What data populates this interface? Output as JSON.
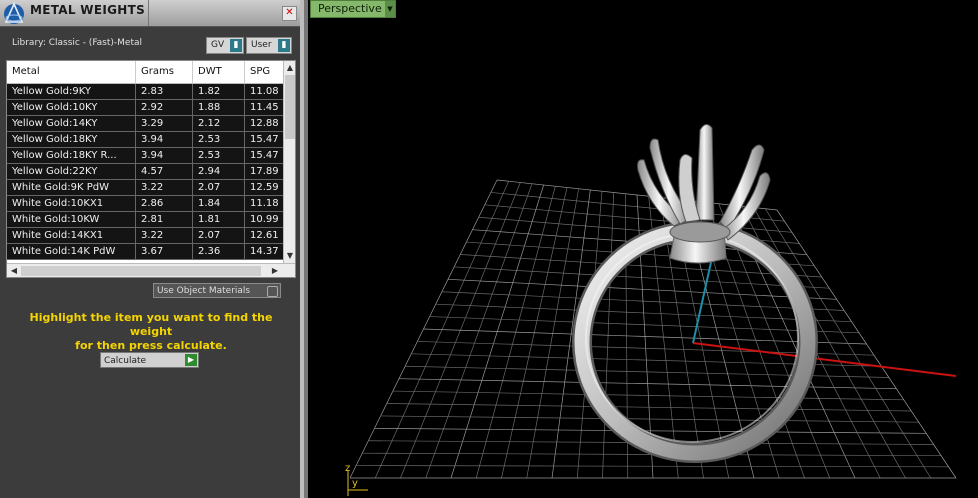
{
  "panel": {
    "title": "METAL WEIGHTS",
    "close_icon": "close-icon",
    "library": "Library: Classic - (Fast)-Metal",
    "toggle_gv": "GV",
    "toggle_user": "User",
    "columns": [
      "Metal",
      "Grams",
      "DWT",
      "SPG"
    ],
    "rows": [
      [
        "Yellow Gold:9KY",
        "2.83",
        "1.82",
        "11.08"
      ],
      [
        "Yellow Gold:10KY",
        "2.92",
        "1.88",
        "11.45"
      ],
      [
        "Yellow Gold:14KY",
        "3.29",
        "2.12",
        "12.88"
      ],
      [
        "Yellow Gold:18KY",
        "3.94",
        "2.53",
        "15.47"
      ],
      [
        "Yellow Gold:18KY R...",
        "3.94",
        "2.53",
        "15.47"
      ],
      [
        "Yellow Gold:22KY",
        "4.57",
        "2.94",
        "17.89"
      ],
      [
        "White Gold:9K PdW",
        "3.22",
        "2.07",
        "12.59"
      ],
      [
        "White Gold:10KX1",
        "2.86",
        "1.84",
        "11.18"
      ],
      [
        "White Gold:10KW",
        "2.81",
        "1.81",
        "10.99"
      ],
      [
        "White Gold:14KX1",
        "3.22",
        "2.07",
        "12.61"
      ],
      [
        "White Gold:14K PdW",
        "3.67",
        "2.36",
        "14.37"
      ]
    ],
    "use_object_materials": "Use Object Materials",
    "hint_line1": "Highlight the item you want to find the weight",
    "hint_line2": "for then press calculate.",
    "calculate": "Calculate"
  },
  "viewport": {
    "view_label": "Perspective",
    "dropdown_icon": "chevron-down-icon",
    "axis_z": "z",
    "axis_y": "y"
  },
  "colors": {
    "hint": "#f5d500",
    "view_tab": "#86b86b",
    "x_axis": "#cc1111",
    "y_axis": "#1e8fa8"
  }
}
